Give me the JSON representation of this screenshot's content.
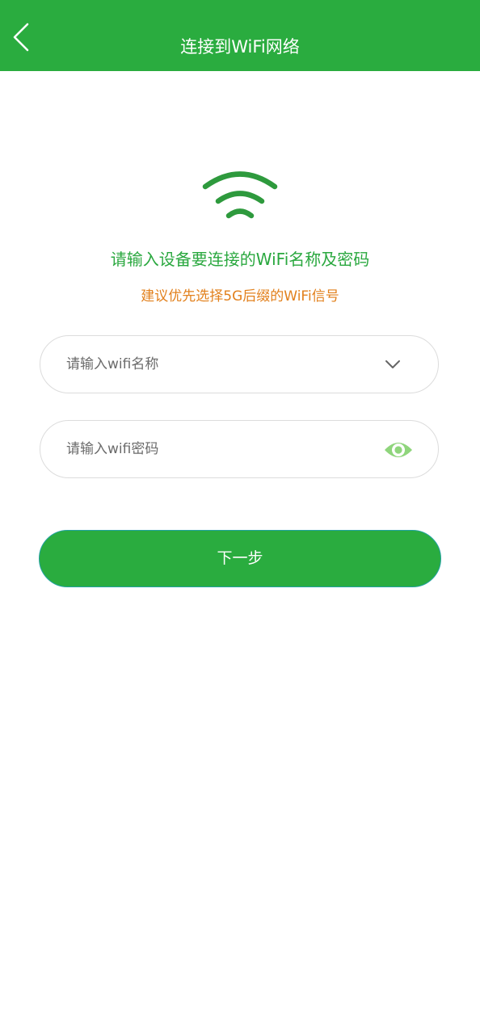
{
  "header": {
    "title": "连接到WiFi网络",
    "back_icon": "chevron-left-icon",
    "background_color": "#2aac3f"
  },
  "main": {
    "wifi_icon": "wifi-icon",
    "prompt": "请输入设备要连接的WiFi名称及密码",
    "prompt_color": "#2aa83f",
    "hint": "建议优先选择5G后缀的WiFi信号",
    "hint_color": "#e2801c"
  },
  "form": {
    "ssid": {
      "value": "",
      "placeholder": "请输入wifi名称",
      "icon": "chevron-down-icon"
    },
    "password": {
      "value": "",
      "placeholder": "请输入wifi密码",
      "icon": "eye-icon"
    },
    "next_label": "下一步"
  }
}
